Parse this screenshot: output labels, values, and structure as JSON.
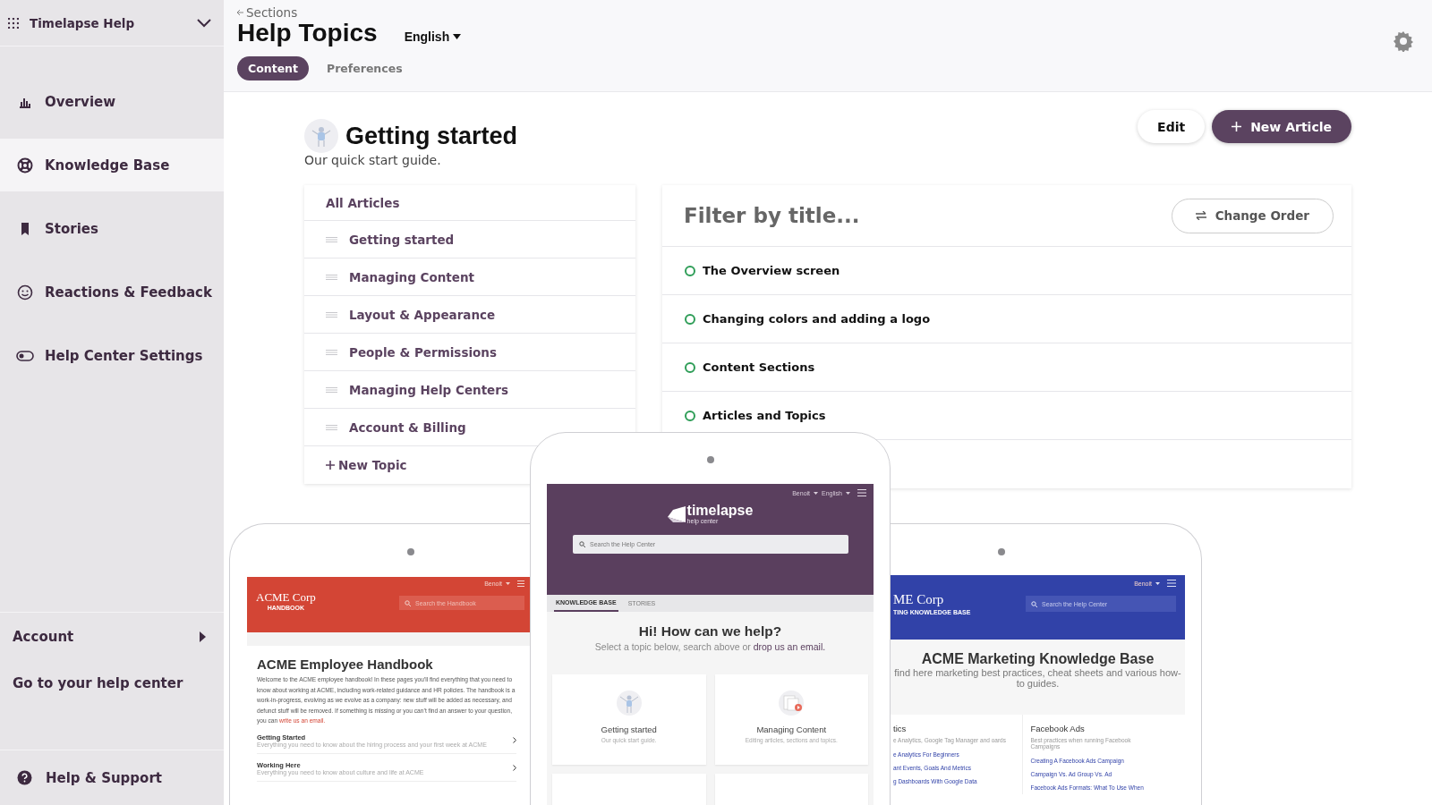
{
  "sidebar": {
    "workspace": "Timelapse Help",
    "items": [
      {
        "label": "Overview",
        "selected": false
      },
      {
        "label": "Knowledge Base",
        "selected": true
      },
      {
        "label": "Stories",
        "selected": false
      },
      {
        "label": "Reactions & Feedback",
        "selected": false
      },
      {
        "label": "Help Center Settings",
        "selected": false
      }
    ],
    "account": "Account",
    "help_center_link": "Go to your help center",
    "support": "Help & Support"
  },
  "header": {
    "back_link": "Sections",
    "title": "Help Topics",
    "language": "English",
    "tabs": [
      {
        "label": "Content",
        "selected": true
      },
      {
        "label": "Preferences",
        "selected": false
      }
    ]
  },
  "section": {
    "title": "Getting started",
    "subtitle": "Our quick start guide.",
    "buttons": [
      {
        "label": "Edit",
        "kind": "secondary"
      },
      {
        "label": "New Article",
        "kind": "primary"
      }
    ]
  },
  "topics": {
    "all_label": "All Articles",
    "items": [
      "Getting started",
      "Managing Content",
      "Layout & Appearance",
      "People & Permissions",
      "Managing Help Centers",
      "Account & Billing"
    ],
    "new_label": "New Topic"
  },
  "articles": {
    "filter_placeholder": "Filter by title...",
    "order_button": "Change Order",
    "rows": [
      "The Overview screen",
      "Changing colors and adding a logo",
      "Content Sections",
      "Articles and Topics"
    ]
  },
  "preview_left": {
    "user": "Benoit",
    "logo": "ACME Corp",
    "logo_subtitle": "HANDBOOK",
    "search_placeholder": "Search the Handbook",
    "title": "ACME Employee Handbook",
    "intro": "Welcome to the ACME employee handbook! In these pages you’ll find everything that you need to know about working at ACME, including work-related guidance and HR policies. The handbook is a work-in-progress, evolving as we evolve as a company: new stuff will be added as necessary, and defunct stuff will be removed. If something is missing or you can’t find an answer to your question, you can",
    "intro_link": "write us an email.",
    "sections": [
      {
        "title": "Getting Started",
        "description": "Everything you need to know about the hiring process and your first week at ACME"
      },
      {
        "title": "Working Here",
        "description": "Everything you need to know about culture and life at ACME"
      }
    ]
  },
  "preview_center": {
    "user": "Benoit",
    "language": "English",
    "logo": "timelapse",
    "logo_subtitle": "help center",
    "search_placeholder": "Search the Help Center",
    "tabs": [
      {
        "label": "KNOWLEDGE BASE",
        "selected": true
      },
      {
        "label": "STORIES",
        "selected": false
      }
    ],
    "heading": "Hi! How can we help?",
    "subheading": "Select a topic below, search above or",
    "subheading_link": "drop us an email.",
    "cards": [
      {
        "title": "Getting started",
        "description": "Our quick start guide."
      },
      {
        "title": "Managing Content",
        "description": "Editing articles, sections and topics."
      }
    ]
  },
  "preview_right": {
    "user": "Benoit",
    "logo": "ME Corp",
    "logo_subtitle": "TING KNOWLEDGE BASE",
    "search_placeholder": "Search the Help Center",
    "title": "ACME Marketing Knowledge Base",
    "subtitle": "find here marketing best practices, cheat sheets and various how-to guides.",
    "columns": [
      {
        "title": "tics",
        "description": "e Analytics, Google Tag Manager and oards",
        "links": [
          "e Analytics For Beginners",
          "ant Events, Goals And Metrics",
          "g Dashboards With Google Data"
        ]
      },
      {
        "title": "Facebook Ads",
        "description": "Best practices when running Facebook Campaigns",
        "links": [
          "Creating A Facebook Ads Campaign",
          "Campaign Vs. Ad Group Vs. Ad",
          "Facebook Ads Formats: What To Use When"
        ]
      }
    ]
  }
}
